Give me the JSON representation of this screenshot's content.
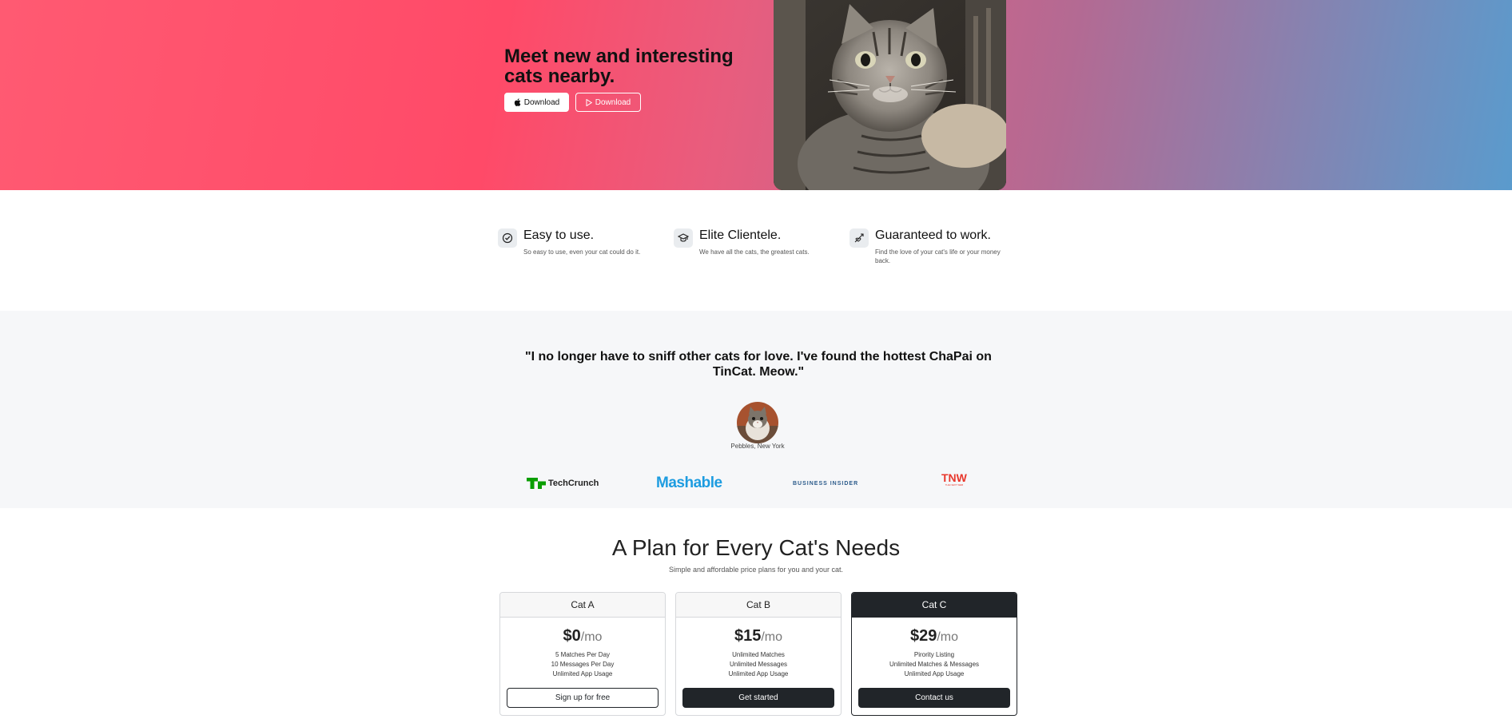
{
  "hero": {
    "title": "Meet new and interesting cats nearby.",
    "download_apple_label": "Download",
    "download_play_label": "Download"
  },
  "features": [
    {
      "title": "Easy to use.",
      "text": "So easy to use, even your cat could do it.",
      "icon": "check-circle-icon"
    },
    {
      "title": "Elite Clientele.",
      "text": "We have all the cats, the greatest cats.",
      "icon": "graduation-cap-icon"
    },
    {
      "title": "Guaranteed to work.",
      "text": "Find the love of your cat's life or your money back.",
      "icon": "cupid-arrow-icon"
    }
  ],
  "testimonial": {
    "quote": "\"I no longer have to sniff other cats for love. I've found the hottest ChaPai on TinCat. Meow.\"",
    "author": "Pebbles, New York"
  },
  "press_logos": {
    "techcrunch": "TechCrunch",
    "mashable": "Mashable",
    "business_insider": "BUSINESS INSIDER",
    "tnw": "TNW",
    "tnw_sub": "THE NEXT WEB"
  },
  "pricing": {
    "title": "A Plan for Every Cat's Needs",
    "subtitle": "Simple and affordable price plans for you and your cat.",
    "plans": [
      {
        "name": "Cat A",
        "price": "$0",
        "period": "/mo",
        "features": [
          "5 Matches Per Day",
          "10 Messages Per Day",
          "Unlimited App Usage"
        ],
        "button": "Sign up for free"
      },
      {
        "name": "Cat B",
        "price": "$15",
        "period": "/mo",
        "features": [
          "Unlimited Matches",
          "Unlimited Messages",
          "Unlimited App Usage"
        ],
        "button": "Get started"
      },
      {
        "name": "Cat C",
        "price": "$29",
        "period": "/mo",
        "features": [
          "Pirority Listing",
          "Unlimited Matches & Messages",
          "Unlimited App Usage"
        ],
        "button": "Contact us"
      }
    ]
  },
  "colors": {
    "hero_start": "#ff5a72",
    "hero_end": "#5a9bcd",
    "dark": "#212529",
    "testimonial_bg": "#f6f7f9",
    "techcrunch_green": "#0a9e01",
    "mashable_blue": "#1d9ce0",
    "tnw_red": "#e8372c"
  }
}
